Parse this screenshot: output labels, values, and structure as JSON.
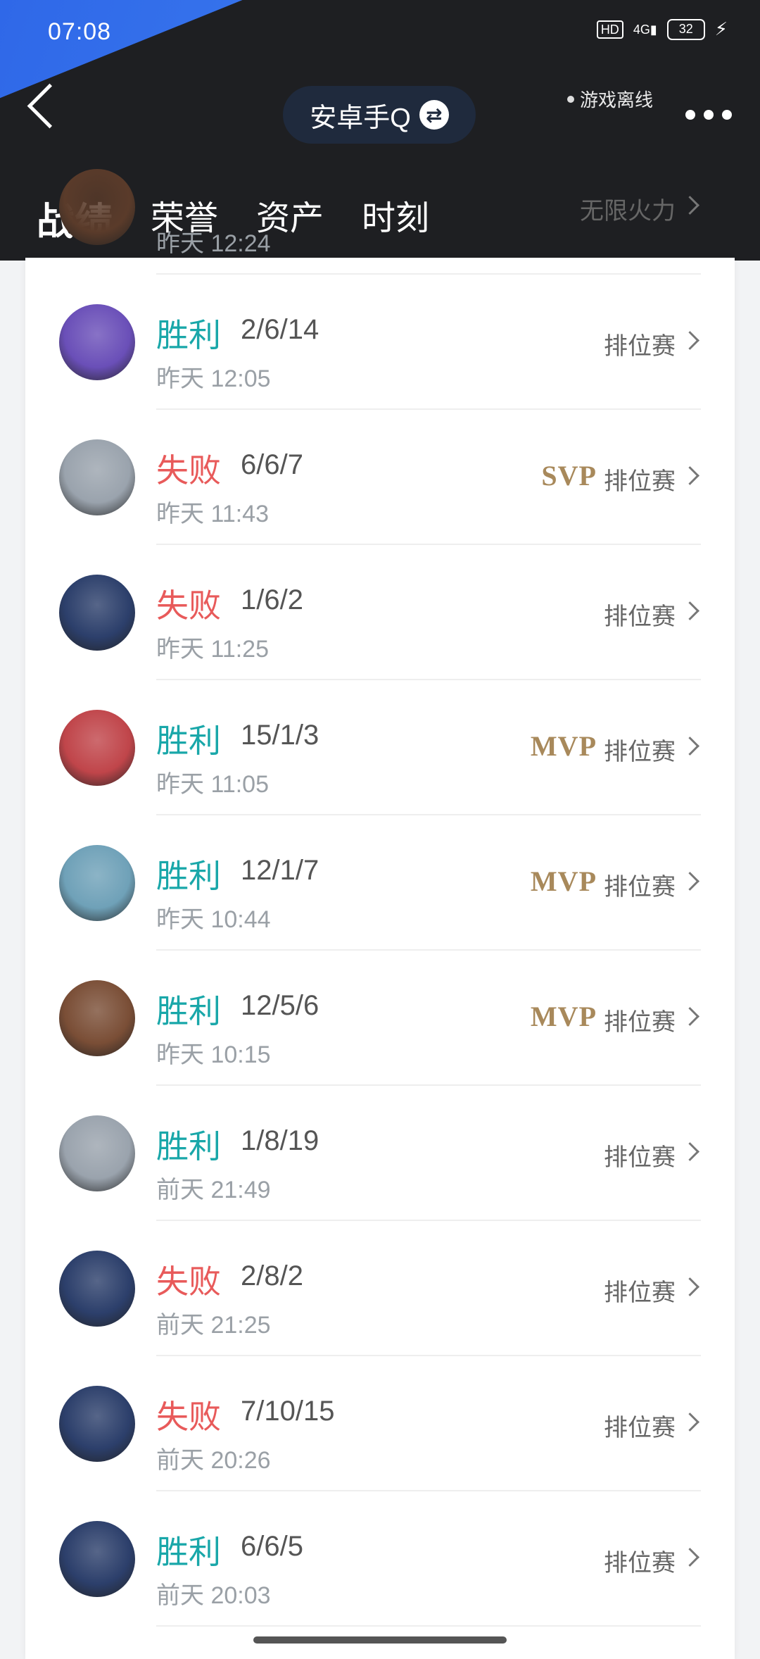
{
  "status_bar": {
    "time": "07:08",
    "hd": "HD",
    "network": "4G",
    "battery": "32"
  },
  "header": {
    "account": "安卓手Q",
    "swap_symbol": "⇄",
    "offline_text": "游戏离线",
    "tabs": [
      "战绩",
      "荣誉",
      "资产",
      "时刻"
    ],
    "active_tab": 0
  },
  "matches": [
    {
      "result": "",
      "type": "win",
      "kda": "",
      "time": "昨天 12:24",
      "badge": "",
      "mode": "无限火力",
      "avatar_color": "#5a3b2a"
    },
    {
      "result": "胜利",
      "type": "win",
      "kda": "2/6/14",
      "time": "昨天 12:05",
      "badge": "",
      "mode": "排位赛",
      "avatar_color": "#6a4fb8"
    },
    {
      "result": "失败",
      "type": "loss",
      "kda": "6/6/7",
      "time": "昨天 11:43",
      "badge": "SVP",
      "mode": "排位赛",
      "avatar_color": "#9aa3ad"
    },
    {
      "result": "失败",
      "type": "loss",
      "kda": "1/6/2",
      "time": "昨天 11:25",
      "badge": "",
      "mode": "排位赛",
      "avatar_color": "#2c3f6b"
    },
    {
      "result": "胜利",
      "type": "win",
      "kda": "15/1/3",
      "time": "昨天 11:05",
      "badge": "MVP",
      "mode": "排位赛",
      "avatar_color": "#c0454a"
    },
    {
      "result": "胜利",
      "type": "win",
      "kda": "12/1/7",
      "time": "昨天 10:44",
      "badge": "MVP",
      "mode": "排位赛",
      "avatar_color": "#6fa1b8"
    },
    {
      "result": "胜利",
      "type": "win",
      "kda": "12/5/6",
      "time": "昨天 10:15",
      "badge": "MVP",
      "mode": "排位赛",
      "avatar_color": "#7a4e36"
    },
    {
      "result": "胜利",
      "type": "win",
      "kda": "1/8/19",
      "time": "前天 21:49",
      "badge": "",
      "mode": "排位赛",
      "avatar_color": "#9aa3ad"
    },
    {
      "result": "失败",
      "type": "loss",
      "kda": "2/8/2",
      "time": "前天 21:25",
      "badge": "",
      "mode": "排位赛",
      "avatar_color": "#2c3f6b"
    },
    {
      "result": "失败",
      "type": "loss",
      "kda": "7/10/15",
      "time": "前天 20:26",
      "badge": "",
      "mode": "排位赛",
      "avatar_color": "#2c3f6b"
    },
    {
      "result": "胜利",
      "type": "win",
      "kda": "6/6/5",
      "time": "前天 20:03",
      "badge": "",
      "mode": "排位赛",
      "avatar_color": "#2c3f6b"
    }
  ]
}
